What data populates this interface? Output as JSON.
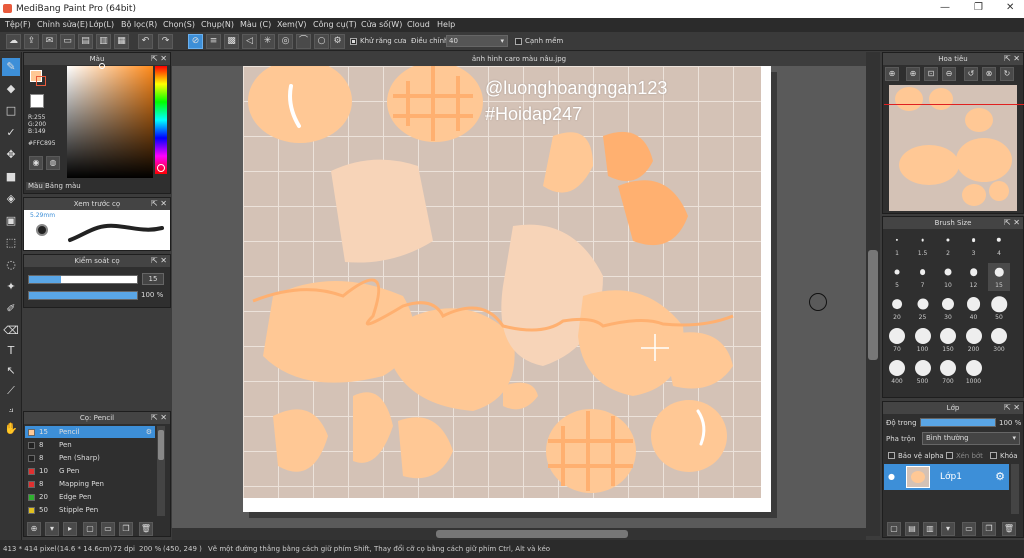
{
  "window": {
    "title": "MediBang Paint Pro (64bit)",
    "controls": [
      "—",
      "❐",
      "✕"
    ]
  },
  "menu": [
    "Tệp(F)",
    "Chỉnh sửa(E)",
    "Lớp(L)",
    "Bộ lọc(R)",
    "Chọn(S)",
    "Chụp(N)",
    "Màu (C)",
    "Xem(V)",
    "Công cụ(T)",
    "Cửa số(W)",
    "Cloud",
    "Help"
  ],
  "toolbar": {
    "antialias_label": "Khử răng cưa",
    "adjust_label": "Điều chỉnh",
    "adjust_value": "40",
    "snap_label": "Cạnh mềm"
  },
  "color_panel": {
    "title": "Màu",
    "r": "R:255",
    "g": "G:200",
    "b": "B:149",
    "hex": "#FFC895",
    "tab_color": "Màu",
    "tab_palette": "Bảng màu",
    "fg_color": "#FFC895"
  },
  "preview_panel": {
    "title": "Xem trước cọ",
    "size": "5.29mm"
  },
  "brush_control": {
    "title": "Kiểm soát cọ",
    "size_value": "15",
    "opacity_value": "100 %",
    "size_fraction": 0.3,
    "opacity_fraction": 1.0
  },
  "brush_list": {
    "title": "Cọ: Pencil",
    "items": [
      {
        "size": "15",
        "name": "Pencil",
        "color": "#FFC895",
        "selected": true
      },
      {
        "size": "8",
        "name": "Pen",
        "color": "#222222",
        "selected": false
      },
      {
        "size": "8",
        "name": "Pen (Sharp)",
        "color": "#222222",
        "selected": false
      },
      {
        "size": "10",
        "name": "G Pen",
        "color": "#e03030",
        "selected": false
      },
      {
        "size": "8",
        "name": "Mapping Pen",
        "color": "#e03030",
        "selected": false
      },
      {
        "size": "20",
        "name": "Edge Pen",
        "color": "#2fb02f",
        "selected": false
      },
      {
        "size": "50",
        "name": "Stipple Pen",
        "color": "#e0c020",
        "selected": false
      }
    ]
  },
  "document": {
    "tab": "ảnh hình caro màu nâu.jpg",
    "watermark_1": "@luonghoangngan123",
    "watermark_2": "#Hoidap247"
  },
  "navigator": {
    "title": "Hoa tiêu"
  },
  "brush_size": {
    "title": "Brush Size",
    "sizes": [
      "1",
      "1.5",
      "2",
      "3",
      "4",
      "5",
      "7",
      "10",
      "12",
      "15",
      "20",
      "25",
      "30",
      "40",
      "50",
      "70",
      "100",
      "150",
      "200",
      "300",
      "400",
      "500",
      "700",
      "1000"
    ],
    "selected": "15"
  },
  "layer_panel": {
    "title": "Lớp",
    "opacity_label": "Độ trong",
    "opacity_value": "100 %",
    "blend_label": "Pha trộn",
    "blend_value": "Bình thường",
    "protect_alpha": "Bảo vệ alpha",
    "clip": "Xén bớt",
    "lock": "Khóa",
    "layer_name": "Lớp1"
  },
  "status": {
    "size": "413 * 414 pixel",
    "cm": "(14.6 * 14.6cm)",
    "dpi": "72 dpi",
    "zoom": "200 %",
    "coords": "(450, 249 )",
    "hint": "Vẽ một đường thẳng bằng cách giữ phím Shift, Thay đổi cỡ cọ bằng cách giữ phím Ctrl, Alt và kéo"
  },
  "colors": {
    "accent": "#3d8fd8",
    "peach": "#FFC895",
    "peach_dark": "#FFB070",
    "bg_canvas": "#d4c2b6"
  }
}
